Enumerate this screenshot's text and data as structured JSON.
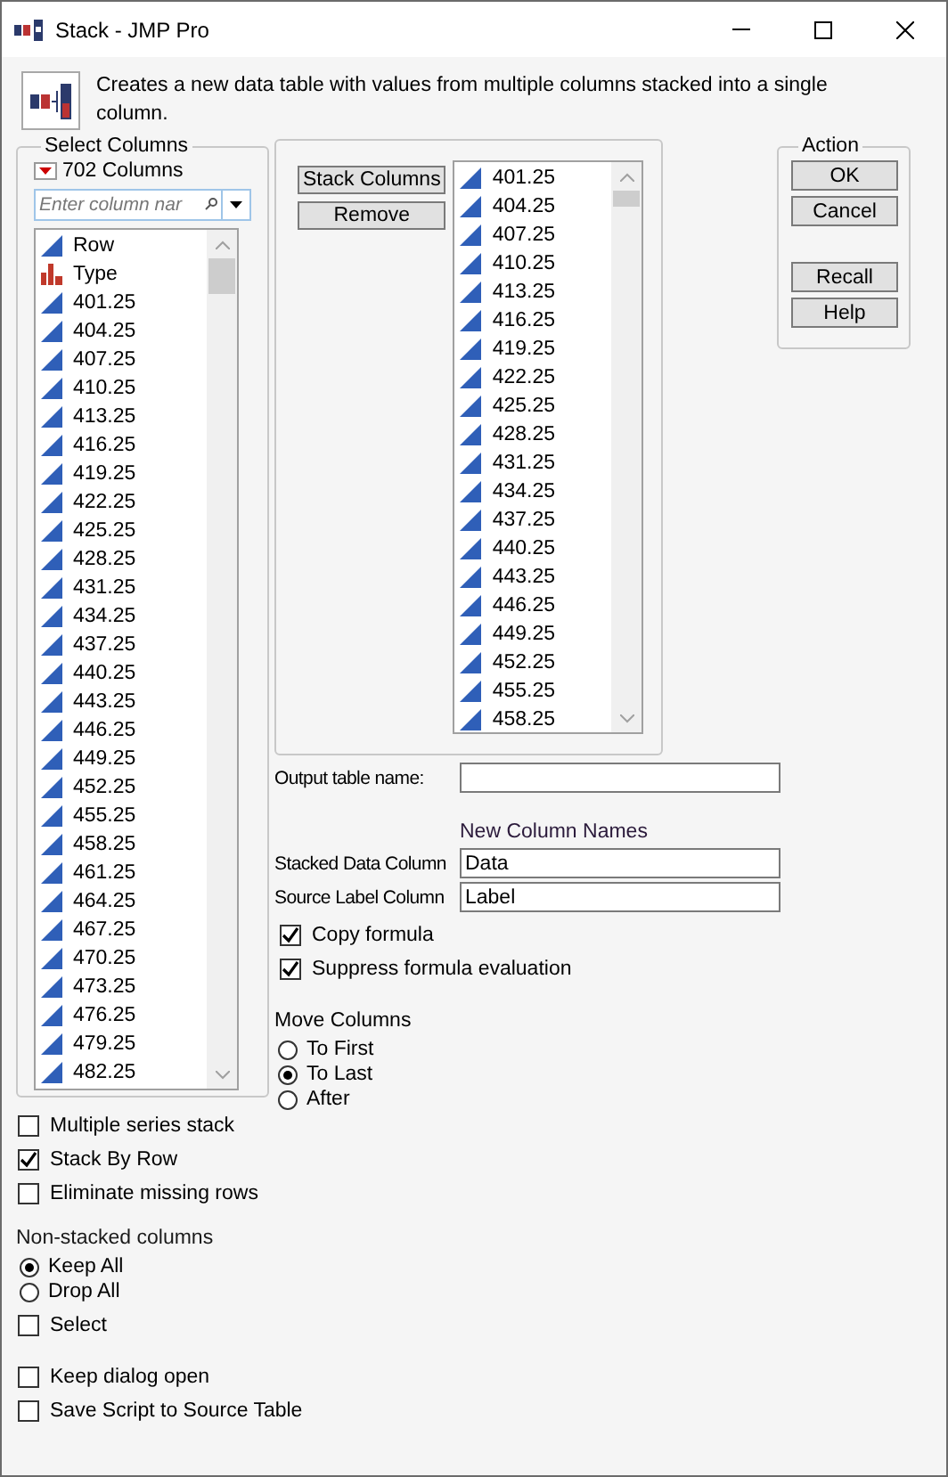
{
  "window": {
    "title": "Stack - JMP Pro"
  },
  "description": "Creates a new data table with values from multiple columns stacked into a single column.",
  "select_columns": {
    "title": "Select Columns",
    "count": "702 Columns",
    "search": {
      "placeholder": "Enter column nar"
    },
    "columns": [
      {
        "name": "Row",
        "kind": "continuous"
      },
      {
        "name": "Type",
        "kind": "nominal"
      },
      {
        "name": "401.25",
        "kind": "continuous"
      },
      {
        "name": "404.25",
        "kind": "continuous"
      },
      {
        "name": "407.25",
        "kind": "continuous"
      },
      {
        "name": "410.25",
        "kind": "continuous"
      },
      {
        "name": "413.25",
        "kind": "continuous"
      },
      {
        "name": "416.25",
        "kind": "continuous"
      },
      {
        "name": "419.25",
        "kind": "continuous"
      },
      {
        "name": "422.25",
        "kind": "continuous"
      },
      {
        "name": "425.25",
        "kind": "continuous"
      },
      {
        "name": "428.25",
        "kind": "continuous"
      },
      {
        "name": "431.25",
        "kind": "continuous"
      },
      {
        "name": "434.25",
        "kind": "continuous"
      },
      {
        "name": "437.25",
        "kind": "continuous"
      },
      {
        "name": "440.25",
        "kind": "continuous"
      },
      {
        "name": "443.25",
        "kind": "continuous"
      },
      {
        "name": "446.25",
        "kind": "continuous"
      },
      {
        "name": "449.25",
        "kind": "continuous"
      },
      {
        "name": "452.25",
        "kind": "continuous"
      },
      {
        "name": "455.25",
        "kind": "continuous"
      },
      {
        "name": "458.25",
        "kind": "continuous"
      },
      {
        "name": "461.25",
        "kind": "continuous"
      },
      {
        "name": "464.25",
        "kind": "continuous"
      },
      {
        "name": "467.25",
        "kind": "continuous"
      },
      {
        "name": "470.25",
        "kind": "continuous"
      },
      {
        "name": "473.25",
        "kind": "continuous"
      },
      {
        "name": "476.25",
        "kind": "continuous"
      },
      {
        "name": "479.25",
        "kind": "continuous"
      },
      {
        "name": "482.25",
        "kind": "continuous"
      }
    ]
  },
  "role_buttons": [
    "Stack Columns",
    "Remove"
  ],
  "stacked_columns": [
    {
      "name": "401.25",
      "kind": "continuous"
    },
    {
      "name": "404.25",
      "kind": "continuous"
    },
    {
      "name": "407.25",
      "kind": "continuous"
    },
    {
      "name": "410.25",
      "kind": "continuous"
    },
    {
      "name": "413.25",
      "kind": "continuous"
    },
    {
      "name": "416.25",
      "kind": "continuous"
    },
    {
      "name": "419.25",
      "kind": "continuous"
    },
    {
      "name": "422.25",
      "kind": "continuous"
    },
    {
      "name": "425.25",
      "kind": "continuous"
    },
    {
      "name": "428.25",
      "kind": "continuous"
    },
    {
      "name": "431.25",
      "kind": "continuous"
    },
    {
      "name": "434.25",
      "kind": "continuous"
    },
    {
      "name": "437.25",
      "kind": "continuous"
    },
    {
      "name": "440.25",
      "kind": "continuous"
    },
    {
      "name": "443.25",
      "kind": "continuous"
    },
    {
      "name": "446.25",
      "kind": "continuous"
    },
    {
      "name": "449.25",
      "kind": "continuous"
    },
    {
      "name": "452.25",
      "kind": "continuous"
    },
    {
      "name": "455.25",
      "kind": "continuous"
    },
    {
      "name": "458.25",
      "kind": "continuous"
    }
  ],
  "output_table": {
    "label": "Output table name:"
  },
  "new_column_names": {
    "heading": "New Column Names",
    "fields": [
      {
        "label": "Stacked Data Column",
        "value": "Data"
      },
      {
        "label": "Source Label Column",
        "value": "Label"
      }
    ]
  },
  "formula_options": [
    {
      "label": "Copy formula",
      "checked": true
    },
    {
      "label": "Suppress formula evaluation",
      "checked": true
    }
  ],
  "move_columns": {
    "title": "Move Columns",
    "options": [
      {
        "label": "To First",
        "selected": false
      },
      {
        "label": "To Last",
        "selected": true
      },
      {
        "label": "After",
        "selected": false
      }
    ]
  },
  "stack_options": [
    {
      "label": "Multiple series stack",
      "checked": false
    },
    {
      "label": "Stack By Row",
      "checked": true
    },
    {
      "label": "Eliminate missing rows",
      "checked": false
    }
  ],
  "non_stacked": {
    "title": "Non-stacked columns",
    "options": [
      {
        "label": "Keep All",
        "selected": true
      },
      {
        "label": "Drop All",
        "selected": false
      }
    ],
    "select": {
      "label": "Select",
      "checked": false
    }
  },
  "dialog_options": [
    {
      "label": "Keep dialog open",
      "checked": false
    },
    {
      "label": "Save Script to Source Table",
      "checked": false
    }
  ],
  "action": {
    "title": "Action",
    "buttons": [
      "OK",
      "Cancel",
      "Recall",
      "Help"
    ]
  }
}
